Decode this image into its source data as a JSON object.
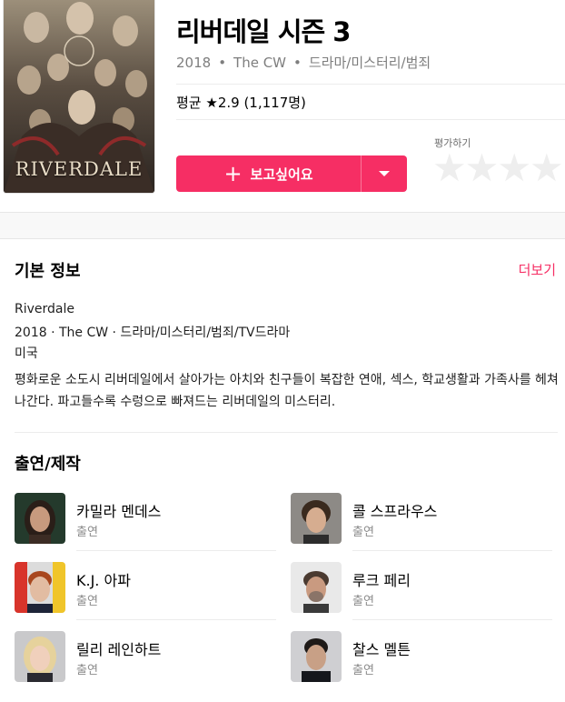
{
  "header": {
    "poster_title": "RIVERDALE",
    "title": "리버데일 시즌 3",
    "year": "2018",
    "network": "The CW",
    "genres": "드라마/미스터리/범죄",
    "rating_text": "평균 ★2.9 (1,117명)",
    "rate_label": "평가하기",
    "wish_label": "보고싶어요"
  },
  "info": {
    "heading": "기본 정보",
    "more": "더보기",
    "original_title": "Riverdale",
    "details": "2018 · The CW · 드라마/미스터리/범죄/TV드라마",
    "country": "미국",
    "description": "평화로운 소도시 리버데일에서 살아가는 아치와 친구들이 복잡한 연애, 섹스, 학교생활과 가족사를 헤쳐나간다. 파고들수록 수렁으로 빠져드는 리버데일의 미스터리."
  },
  "cast": {
    "heading": "출연/제작",
    "items": [
      {
        "name": "카밀라 멘데스",
        "role": "출연"
      },
      {
        "name": "콜 스프라우스",
        "role": "출연"
      },
      {
        "name": "K.J. 아파",
        "role": "출연"
      },
      {
        "name": "루크 페리",
        "role": "출연"
      },
      {
        "name": "릴리 레인하트",
        "role": "출연"
      },
      {
        "name": "찰스 멜튼",
        "role": "출연"
      }
    ]
  },
  "colors": {
    "accent": "#f62e64",
    "muted_text": "#7e7e7e",
    "star_empty": "#eeeeee"
  }
}
